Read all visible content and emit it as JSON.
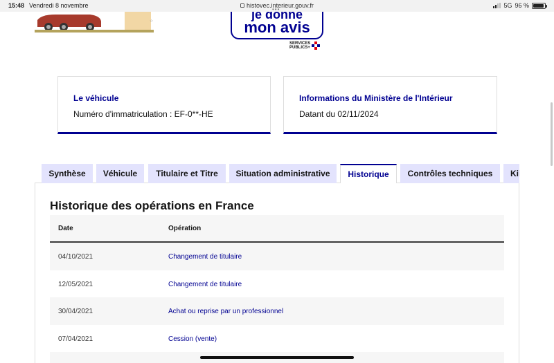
{
  "status_bar": {
    "time": "15:48",
    "date": "Vendredi 8 novembre",
    "url": "histovec.interieur.gouv.fr",
    "network": "5G",
    "battery": "96 %",
    "battery_level": 0.96
  },
  "header": {
    "avis_button_partial": "je donne",
    "avis_button_label": "mon avis",
    "services_publics_line1": "SERVICES",
    "services_publics_line2": "PUBLICS+"
  },
  "cards": {
    "vehicle": {
      "title": "Le véhicule",
      "text": "Numéro d'immatriculation : EF-0**-HE"
    },
    "ministry": {
      "title": "Informations du Ministère de l'Intérieur",
      "text": "Datant du 02/11/2024"
    }
  },
  "tabs": [
    {
      "label": "Synthèse"
    },
    {
      "label": "Véhicule"
    },
    {
      "label": "Titulaire et Titre"
    },
    {
      "label": "Situation administrative"
    },
    {
      "label": "Historique",
      "active": true
    },
    {
      "label": "Contrôles techniques"
    },
    {
      "label": "Kilométrage"
    }
  ],
  "section": {
    "title": "Historique des opérations en France"
  },
  "table": {
    "headers": [
      "Date",
      "Opération"
    ],
    "rows": [
      {
        "date": "04/10/2021",
        "operation": "Changement de titulaire"
      },
      {
        "date": "12/05/2021",
        "operation": "Changement de titulaire"
      },
      {
        "date": "30/04/2021",
        "operation": "Achat ou reprise par un professionnel"
      },
      {
        "date": "07/04/2021",
        "operation": "Cession (vente)"
      }
    ]
  },
  "colors": {
    "accent": "#000091",
    "tab_bg": "#e3e3fd",
    "row_alt": "#f6f6f6"
  }
}
